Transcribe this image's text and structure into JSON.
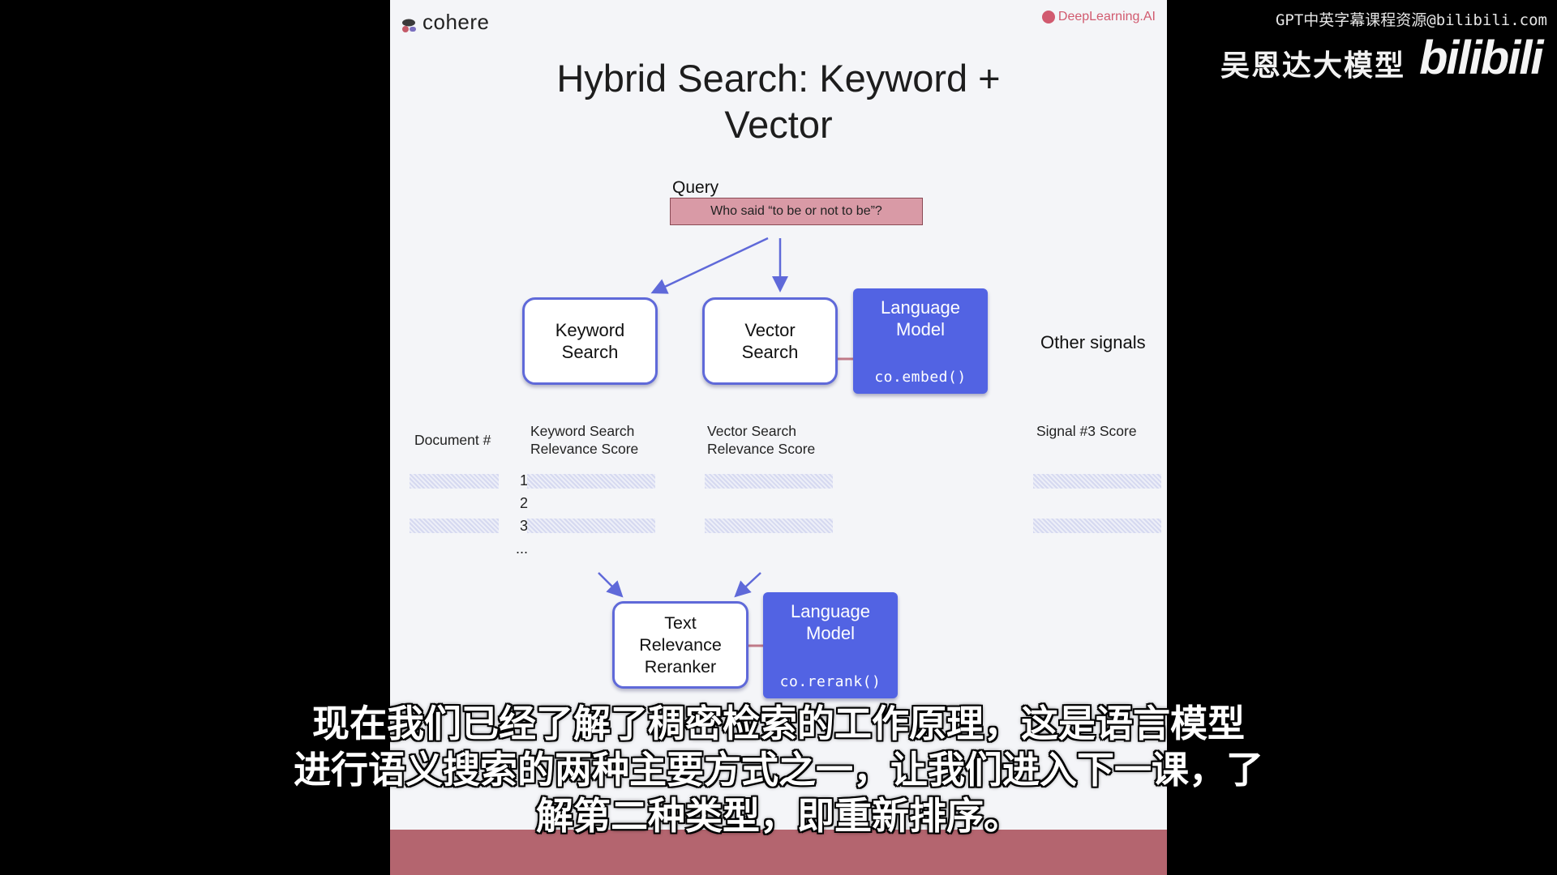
{
  "slide": {
    "brand_left": "cohere",
    "brand_right": "DeepLearning.AI",
    "title_line1": "Hybrid Search: Keyword +",
    "title_line2": "Vector",
    "query_label": "Query",
    "query_text": "Who said “to be or not to be”?",
    "keyword_search_line1": "Keyword",
    "keyword_search_line2": "Search",
    "vector_search_line1": "Vector",
    "vector_search_line2": "Search",
    "language_model_line1": "Language",
    "language_model_line2": "Model",
    "embed_code": "co.embed()",
    "other_signals": "Other signals",
    "table": {
      "col_document": "Document  #",
      "col_keyword_line1": "Keyword Search",
      "col_keyword_line2": "Relevance Score",
      "col_vector_line1": "Vector Search",
      "col_vector_line2": "Relevance Score",
      "col_signal": "Signal #3 Score",
      "rows": [
        "1",
        "2",
        "3",
        "..."
      ]
    },
    "reranker_line1": "Text",
    "reranker_line2": "Relevance",
    "reranker_line3": "Reranker",
    "rerank_code": "co.rerank()"
  },
  "overlay": {
    "watermark": "GPT中英字幕课程资源@bilibili.com",
    "channel": "吴恩达大模型",
    "bili_logo": "bilibili"
  },
  "subtitles": {
    "line1": "现在我们已经了解了稠密检索的工作原理，这是语言模型",
    "line2": "进行语义搜索的两种主要方式之一，让我们进入下一课，了",
    "line3": "解第二种类型，即重新排序。"
  },
  "colors": {
    "accent_blue": "#5263e3",
    "node_border": "#5f69d9",
    "query_fill": "#d99aa6",
    "bottom_bar": "#b4656f"
  }
}
